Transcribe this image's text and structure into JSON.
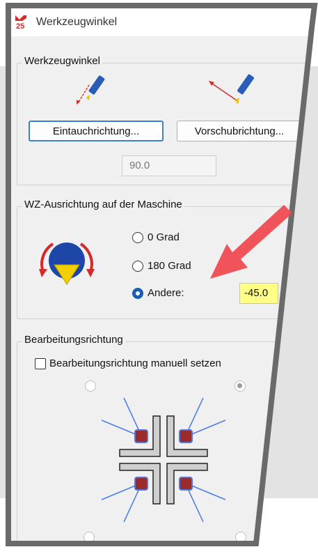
{
  "window": {
    "title": "Werkzeugwinkel",
    "logo_text": "25"
  },
  "tool_angle": {
    "group_label": "Werkzeugwinkel",
    "plunge_button": "Eintauchrichtung...",
    "feed_button": "Vorschubrichtung...",
    "angle_value": "90.0"
  },
  "orientation": {
    "group_label": "WZ-Ausrichtung auf der Maschine",
    "options": [
      {
        "label": "0 Grad",
        "selected": false
      },
      {
        "label": "180 Grad",
        "selected": false
      },
      {
        "label": "Andere:",
        "selected": true
      }
    ],
    "other_value": "-45.0"
  },
  "machining": {
    "group_label": "Bearbeitungsrichtung",
    "manual_checkbox_label": "Bearbeitungsrichtung manuell setzen",
    "manual_checked": false
  },
  "colors": {
    "accent": "#1a5fb4",
    "arrow": "#e8505b",
    "highlight": "#ffff88"
  }
}
